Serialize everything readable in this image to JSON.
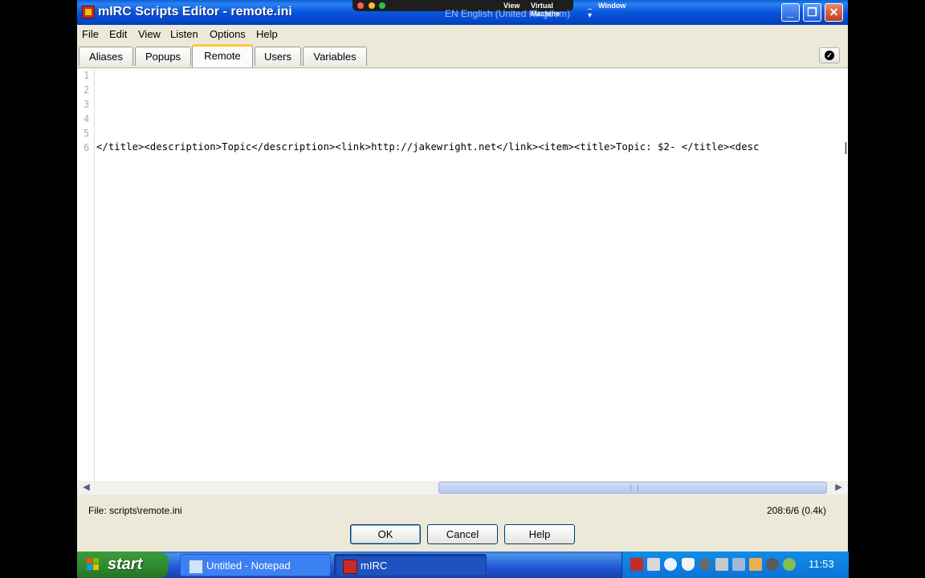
{
  "window": {
    "title": "mIRC Scripts Editor - remote.ini",
    "controls": {
      "minimize": "_",
      "restore": "❐",
      "close": "✕"
    }
  },
  "vm_bar": {
    "menus": [
      "View",
      "Virtual Machine",
      "Window"
    ]
  },
  "language_bar": "EN English (United Kingdom)",
  "menu": [
    "File",
    "Edit",
    "View",
    "Listen",
    "Options",
    "Help"
  ],
  "tabs": [
    {
      "label": "Aliases",
      "active": false
    },
    {
      "label": "Popups",
      "active": false
    },
    {
      "label": "Remote",
      "active": true
    },
    {
      "label": "Users",
      "active": false
    },
    {
      "label": "Variables",
      "active": false
    }
  ],
  "editor": {
    "line_numbers": [
      "1",
      "2",
      "3",
      "4",
      "5",
      "6"
    ],
    "line6": "</title><description>Topic</description><link>http://jakewright.net</link><item><title>Topic: $2- </title><desc"
  },
  "status": {
    "file": "File: scripts\\remote.ini",
    "position": "208:6/6 (0.4k)"
  },
  "buttons": {
    "ok": "OK",
    "cancel": "Cancel",
    "help": "Help"
  },
  "taskbar": {
    "start": "start",
    "items": [
      "Untitled - Notepad",
      "mIRC"
    ],
    "clock": "11:53"
  },
  "colors": {
    "titlebar": "#0A5FD8",
    "active_tab_accent": "#FFC83C",
    "start_green": "#3C9A3C",
    "tray": "#0F8DE8"
  }
}
